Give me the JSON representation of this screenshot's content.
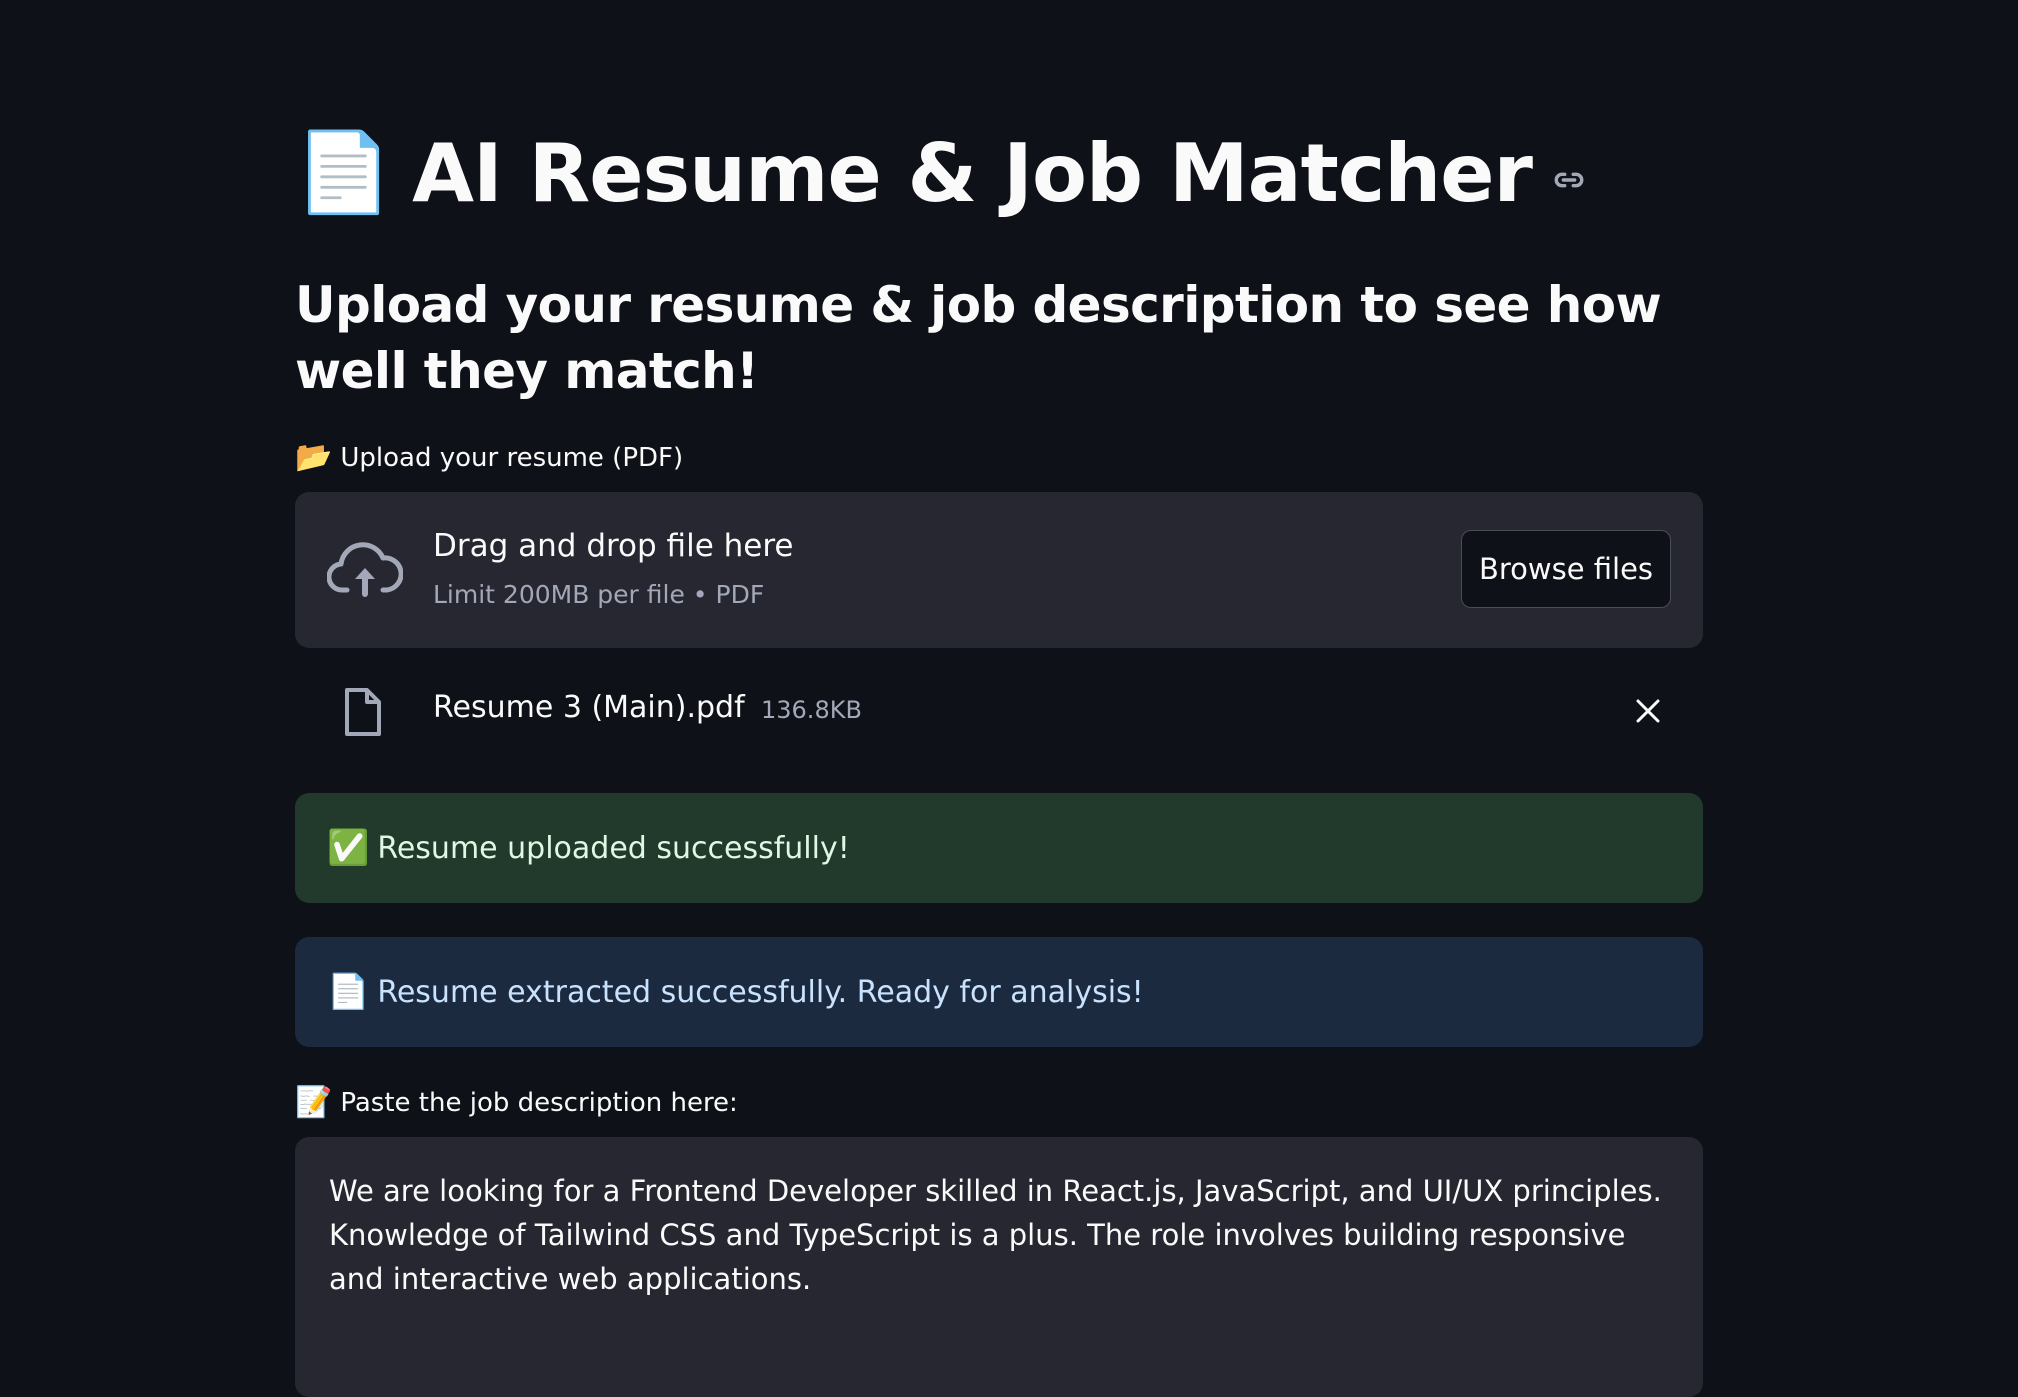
{
  "header": {
    "title_emoji": "📄",
    "title": "AI Resume & Job Matcher",
    "subheader": "Upload your resume & job description to see how well they match!"
  },
  "resume_upload": {
    "label_emoji": "📂",
    "label": "Upload your resume (PDF)",
    "dropzone_title": "Drag and drop file here",
    "dropzone_limit": "Limit 200MB per file • PDF",
    "browse_button": "Browse files",
    "uploaded_file": {
      "name": "Resume 3 (Main).pdf",
      "size": "136.8KB"
    }
  },
  "alerts": {
    "success_emoji": "✅",
    "success": "Resume uploaded successfully!",
    "info_emoji": "📄",
    "info": "Resume extracted successfully. Ready for analysis!"
  },
  "job_description": {
    "label_emoji": "📝",
    "label": "Paste the job description here:",
    "value": "We are looking for a Frontend Developer skilled in React.js, JavaScript, and UI/UX principles. Knowledge of Tailwind CSS and TypeScript is a plus. The role involves building responsive and interactive web applications."
  },
  "colors": {
    "background": "#0e1117",
    "panel": "#262730",
    "success_bg": "#213a2b",
    "info_bg": "#1c2a40"
  },
  "icons": {
    "anchor": "link-icon",
    "upload": "cloud-upload-icon",
    "file": "file-icon",
    "remove": "close-icon"
  }
}
